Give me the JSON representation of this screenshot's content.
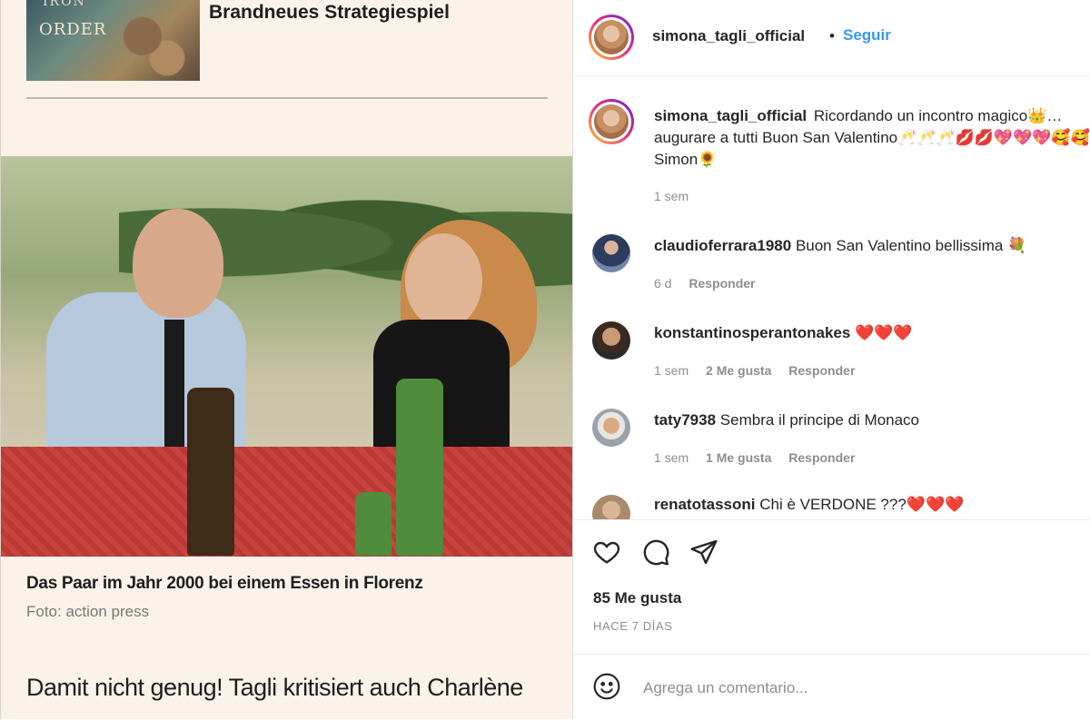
{
  "article": {
    "ad_thumb_line1": "IRON",
    "ad_thumb_line2": "ORDER",
    "ad_headline": "Brandneues Strategiespiel",
    "photo_caption": "Das Paar im Jahr 2000 bei einem Essen in Florenz",
    "photo_credit": "Foto: action press",
    "sub_headline": "Damit nicht genug! Tagli kritisiert auch Charlène"
  },
  "post": {
    "author": "simona_tagli_official",
    "separator": "•",
    "follow_label": "Seguir",
    "caption_user": "simona_tagli_official",
    "caption_line1": "Ricordando un incontro magico👑…",
    "caption_line2": "augurare a tutti Buon San Valentino🥂🥂🥂💋💋💖💖💖🥰🥰",
    "caption_line3": "Simon🌻",
    "caption_time": "1 sem"
  },
  "comments": [
    {
      "user": "claudioferrara1980",
      "text": "Buon San Valentino bellissima 💐",
      "time": "6 d",
      "likes": "",
      "reply": "Responder"
    },
    {
      "user": "konstantinosperantonakes",
      "text": "❤️❤️❤️",
      "time": "1 sem",
      "likes": "2 Me gusta",
      "reply": "Responder"
    },
    {
      "user": "taty7938",
      "text": "Sembra il principe di Monaco",
      "time": "1 sem",
      "likes": "1 Me gusta",
      "reply": "Responder"
    },
    {
      "user": "renatotassoni",
      "text": "Chi è VERDONE ???❤️❤️❤️",
      "time": "",
      "likes": "",
      "reply": ""
    }
  ],
  "actions": {
    "likes_label": "85 Me gusta",
    "date_label": "HACE 7 DÍAS",
    "comment_placeholder": "Agrega un comentario..."
  },
  "icons": {
    "like": "heart-icon",
    "comment": "comment-bubble-icon",
    "share": "paper-plane-icon",
    "emoji": "smiley-icon"
  },
  "colors": {
    "link_blue": "#3897f0",
    "article_bg": "#fbf3ea",
    "text": "#262626",
    "muted": "#8e8e8e"
  }
}
